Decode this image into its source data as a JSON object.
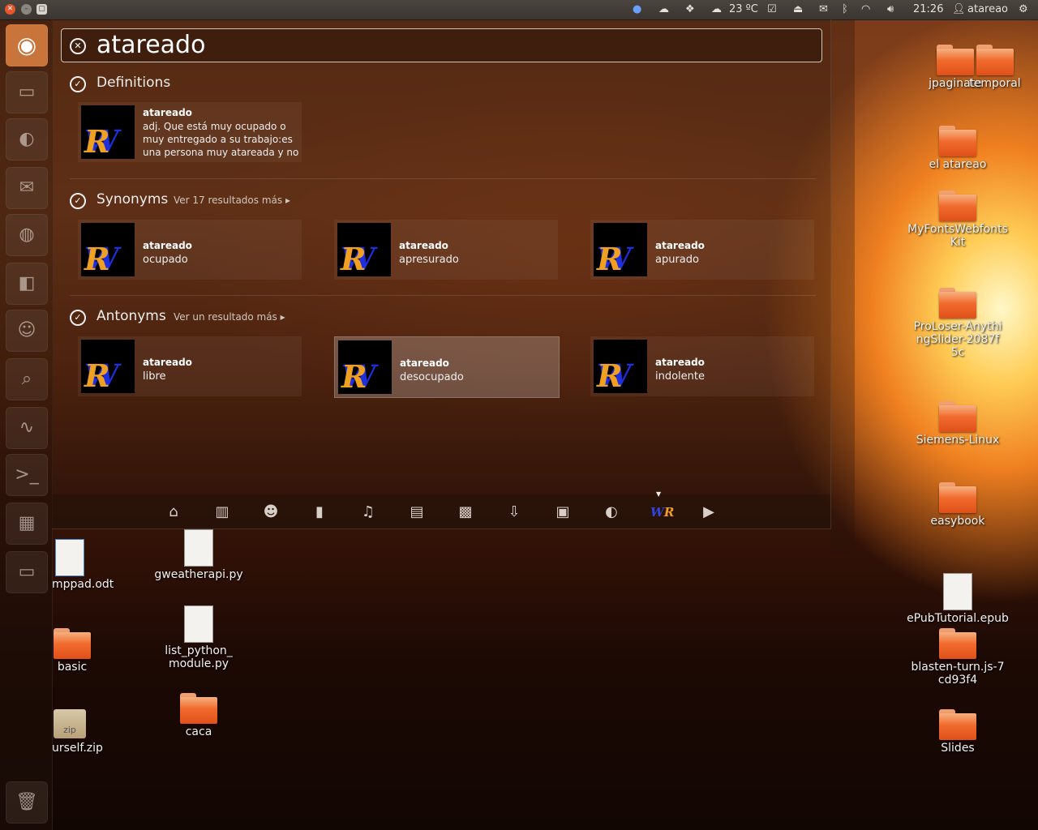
{
  "topbar": {
    "temperature": "23 ºC",
    "time": "21:26",
    "user": "atareao"
  },
  "search": {
    "query": "atareado"
  },
  "sections": {
    "definitions": {
      "title": "Definitions",
      "item": {
        "word": "atareado",
        "definition": "adj. Que está muy ocupado o muy entregado a su trabajo:es una persona muy atareada y no"
      }
    },
    "synonyms": {
      "title": "Synonyms",
      "more": "Ver 17 resultados más",
      "items": [
        {
          "word": "atareado",
          "definition": "ocupado"
        },
        {
          "word": "atareado",
          "definition": "apresurado"
        },
        {
          "word": "atareado",
          "definition": "apurado"
        }
      ]
    },
    "antonyms": {
      "title": "Antonyms",
      "more": "Ver un resultado más",
      "items": [
        {
          "word": "atareado",
          "definition": "libre"
        },
        {
          "word": "atareado",
          "definition": "desocupado"
        },
        {
          "word": "atareado",
          "definition": "indolente"
        }
      ]
    }
  },
  "desktop_icons": {
    "right": [
      {
        "label": "jpaginate"
      },
      {
        "label": "temporal"
      },
      {
        "label": "el atareao"
      },
      {
        "label": "MyFontsWebfontsKit"
      },
      {
        "label": "ProLoser-AnythingSlider-2087f5c"
      },
      {
        "label": "Siemens-Linux"
      },
      {
        "label": "easybook"
      },
      {
        "label": "ePubTutorial.epub"
      },
      {
        "label": "blasten-turn.js-7cd93f4"
      },
      {
        "label": "Slides"
      }
    ],
    "left": [
      {
        "label": "mppad.odt"
      },
      {
        "label": "gweatherapi.py"
      },
      {
        "label": "list_python_module.py"
      },
      {
        "label": "basic"
      },
      {
        "label": "caca"
      },
      {
        "label": "urself.zip"
      }
    ]
  },
  "colors": {
    "accent": "#f06a2c",
    "wr_blue": "#1d2fe0",
    "wr_orange": "#f0a020"
  }
}
